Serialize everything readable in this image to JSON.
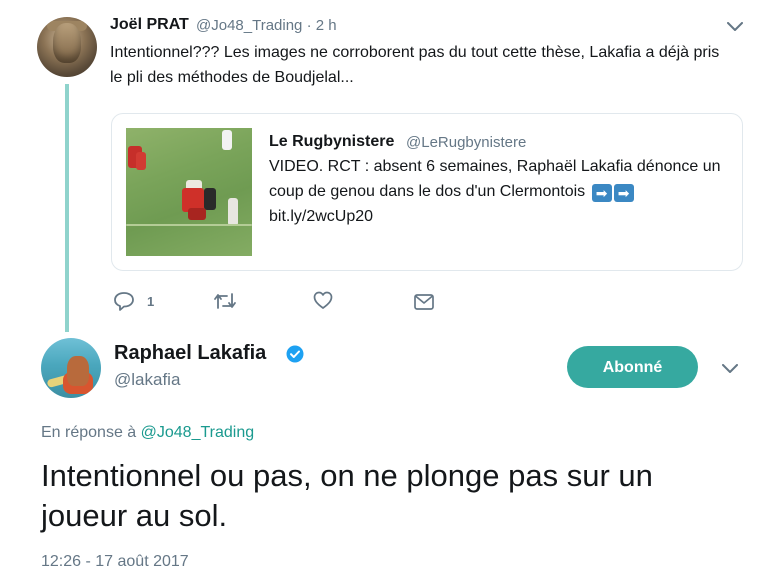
{
  "parent_tweet": {
    "author_name": "Joël PRAT",
    "author_handle": "@Jo48_Trading",
    "separator_time": "· 2 h",
    "text": "Intentionnel??? Les images ne corroborent pas du tout cette thèse, Lakafia a déjà pris le pli des méthodes de Boudjelal...",
    "quoted": {
      "author_name": "Le Rugbynistere",
      "author_handle": "@LeRugbynistere",
      "text": "VIDEO. RCT : absent 6 semaines, Raphaël Lakafia dénonce un coup de genou dans le dos d'un Clermontois",
      "emoji": "➡",
      "link": "bit.ly/2wcUp20"
    },
    "actions": {
      "reply_count": "1"
    },
    "icons": [
      "chevron-down-icon",
      "reply-icon",
      "retweet-icon",
      "like-icon",
      "message-icon"
    ]
  },
  "main_tweet": {
    "author_name": "Raphael Lakafia",
    "author_handle": "@lakafia",
    "follow_label": "Abonné",
    "reply_prefix": "En réponse à",
    "reply_mention": "@Jo48_Trading",
    "text": "Intentionnel ou pas, on ne plonge pas sur un joueur au sol.",
    "timestamp": "12:26 - 17 août 2017"
  },
  "colors": {
    "accent": "#36a9a0",
    "thread_line": "#8fd3cc",
    "mention": "#1b9a8f",
    "verified": "#1da1f2",
    "secondary_text": "#657786"
  }
}
